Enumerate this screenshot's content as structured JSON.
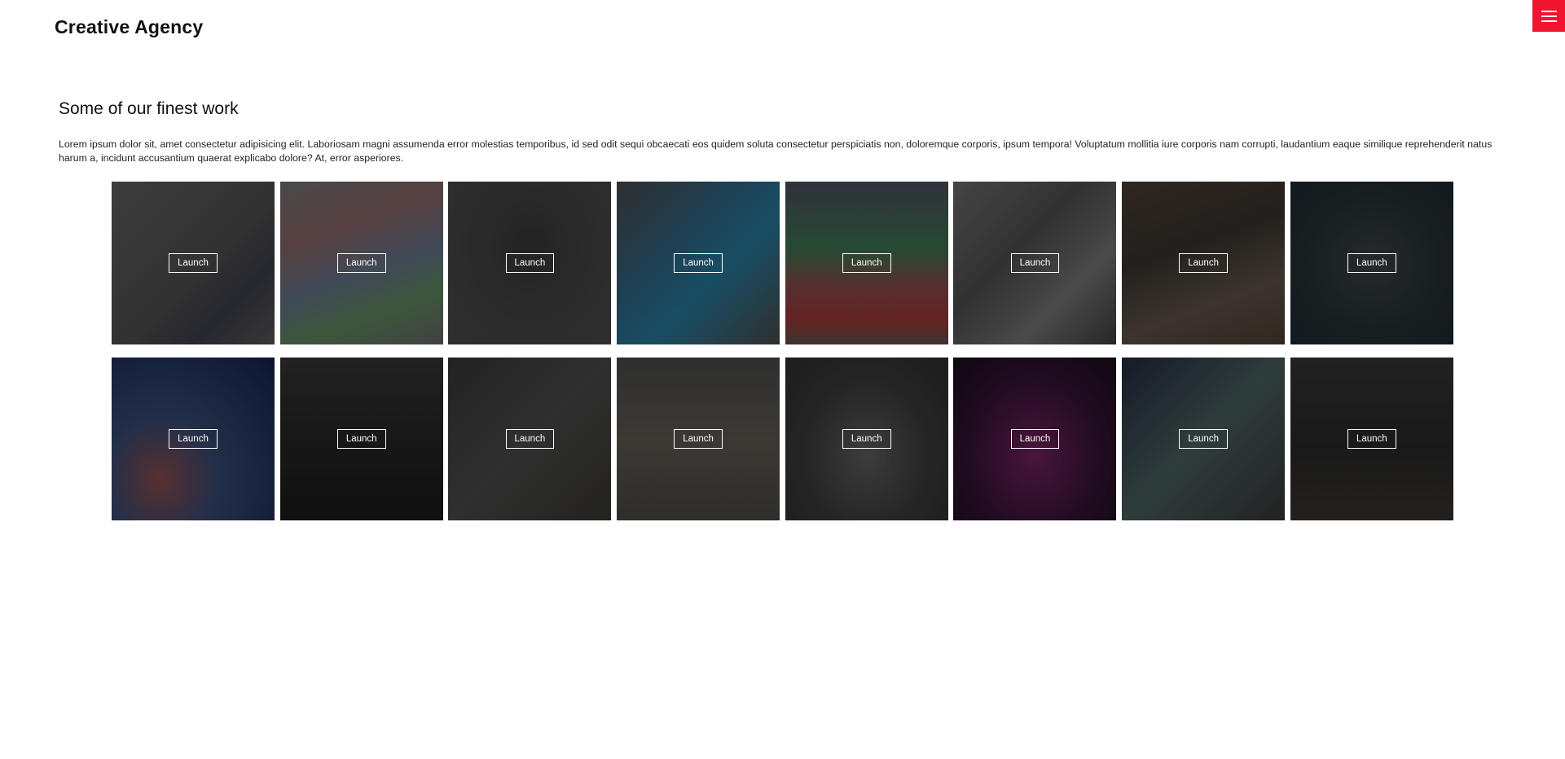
{
  "header": {
    "brand": "Creative Agency",
    "menu_icon": "hamburger-menu-icon",
    "accent_color": "#f0142f"
  },
  "portfolio": {
    "title": "Some of our finest work",
    "intro": "Lorem ipsum dolor sit, amet consectetur adipisicing elit. Laboriosam magni assumenda error molestias temporibus, id sed odit sequi obcaecati eos quidem soluta consectetur perspiciatis non, doloremque corporis, ipsum tempora! Voluptatum mollitia iure corporis nam corrupti, laudantium eaque similique reprehenderit natus harum a, incidunt accusantium quaerat explicabo dolore? At, error asperiores.",
    "items": [
      {
        "launch_label": "Launch"
      },
      {
        "launch_label": "Launch"
      },
      {
        "launch_label": "Launch"
      },
      {
        "launch_label": "Launch"
      },
      {
        "launch_label": "Launch"
      },
      {
        "launch_label": "Launch"
      },
      {
        "launch_label": "Launch"
      },
      {
        "launch_label": "Launch"
      },
      {
        "launch_label": "Launch"
      },
      {
        "launch_label": "Launch"
      },
      {
        "launch_label": "Launch"
      },
      {
        "launch_label": "Launch"
      },
      {
        "launch_label": "Launch"
      },
      {
        "launch_label": "Launch"
      },
      {
        "launch_label": "Launch"
      },
      {
        "launch_label": "Launch"
      }
    ]
  }
}
